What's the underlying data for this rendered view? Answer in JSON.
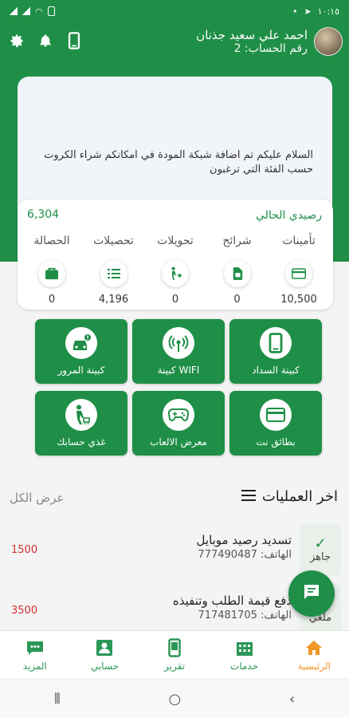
{
  "status_bar": {
    "time": "١٠:١٥"
  },
  "header": {
    "user_name": "احمد علي سعيد جذنان",
    "account_number": "رقم الحساب: 2",
    "icons": [
      "phone-icon",
      "bell-icon",
      "gear-icon"
    ]
  },
  "notice": {
    "text": "السلام عليكم تم اضافة شبكة المودة في امكانكم شراء الكروت حسب الفئة التي ترغبون"
  },
  "balance": {
    "label": "رصيدي الحالي",
    "value": "6,304",
    "stats": [
      {
        "label": "تأمينات",
        "value": "10,500",
        "icon": "card-icon"
      },
      {
        "label": "شرائح",
        "value": "0",
        "icon": "sim-icon"
      },
      {
        "label": "تحويلات",
        "value": "0",
        "icon": "transfer-icon"
      },
      {
        "label": "تحصيلات",
        "value": "4,196",
        "icon": "list-icon"
      },
      {
        "label": "الحصالة",
        "value": "0",
        "icon": "wallet-icon"
      }
    ]
  },
  "services": [
    {
      "label": "كبينة السداد",
      "icon": "phone-icon"
    },
    {
      "label": "WIFI كبينة",
      "icon": "wifi-icon"
    },
    {
      "label": "كبينة المرور",
      "icon": "car-icon"
    },
    {
      "label": "بطائق نت",
      "icon": "card-icon"
    },
    {
      "label": "معرض الالعاب",
      "icon": "gamepad-icon"
    },
    {
      "label": "غذي حسابك",
      "icon": "person-cart-icon"
    }
  ],
  "operations": {
    "title": "اخر العمليات",
    "view_all": "عرض الكل",
    "items": [
      {
        "status": "جاهز",
        "title": "تسديد رصيد موبايل",
        "phone": "الهاتف: 777490487",
        "amount": "1500"
      },
      {
        "status": "ملغي",
        "title": "دفع قيمة الطلب وتنفيذه",
        "phone": "الهاتف: 717481705",
        "amount": "3500"
      }
    ]
  },
  "bottom_nav": [
    {
      "label": "الرئيسية",
      "icon": "home-icon",
      "active": true
    },
    {
      "label": "خدمات",
      "icon": "building-icon",
      "active": false
    },
    {
      "label": "تقرير",
      "icon": "phone-report-icon",
      "active": false
    },
    {
      "label": "حسابي",
      "icon": "profile-icon",
      "active": false
    },
    {
      "label": "المزيد",
      "icon": "more-icon",
      "active": false
    }
  ],
  "colors": {
    "primary": "#1f8f47",
    "active_nav": "#f0962a",
    "amount": "#d32f2f"
  }
}
